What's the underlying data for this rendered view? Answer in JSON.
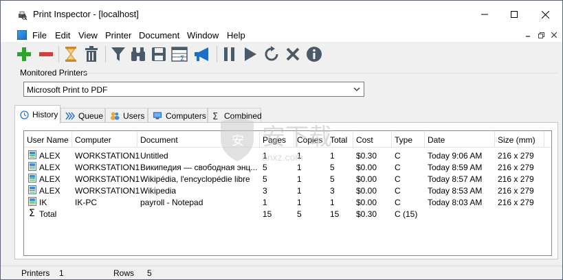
{
  "window": {
    "title": "Print Inspector - [localhost]"
  },
  "menu": [
    "File",
    "Edit",
    "View",
    "Printer",
    "Document",
    "Window",
    "Help"
  ],
  "toolbar": {
    "icons": [
      "add-icon",
      "remove-icon",
      "hourglass-icon",
      "trash-icon",
      "filter-icon",
      "binoculars-icon",
      "save-icon",
      "columns-sum-icon",
      "megaphone-icon",
      "pause-icon",
      "play-icon",
      "refresh-icon",
      "cancel-icon",
      "info-icon"
    ]
  },
  "monitored": {
    "label": "Monitored Printers",
    "selected": "Microsoft Print to PDF"
  },
  "tabs": [
    {
      "label": "History"
    },
    {
      "label": "Queue"
    },
    {
      "label": "Users"
    },
    {
      "label": "Computers"
    },
    {
      "label": "Combined"
    }
  ],
  "table": {
    "columns": [
      "User Name",
      "Computer",
      "Document",
      "Pages",
      "Copies",
      "Total",
      "Cost",
      "Type",
      "Date",
      "Size (mm)"
    ],
    "rows": [
      {
        "user": "ALEX",
        "computer": "WORKSTATION1",
        "document": "Untitled",
        "pages": "1",
        "copies": "1",
        "total": "1",
        "cost": "$0.30",
        "type": "C",
        "date": "Today 9:06 AM",
        "size": "216 x 279"
      },
      {
        "user": "ALEX",
        "computer": "WORKSTATION1",
        "document": "Википедия — свободная энц...",
        "pages": "5",
        "copies": "1",
        "total": "5",
        "cost": "$0.00",
        "type": "C",
        "date": "Today 8:59 AM",
        "size": "216 x 279"
      },
      {
        "user": "ALEX",
        "computer": "WORKSTATION1",
        "document": "Wikipédia, l'encyclopédie libre",
        "pages": "5",
        "copies": "1",
        "total": "5",
        "cost": "$0.00",
        "type": "C",
        "date": "Today 8:57 AM",
        "size": "216 x 279"
      },
      {
        "user": "ALEX",
        "computer": "WORKSTATION1",
        "document": "Wikipedia",
        "pages": "3",
        "copies": "1",
        "total": "3",
        "cost": "$0.00",
        "type": "C",
        "date": "Today 8:53 AM",
        "size": "216 x 279"
      },
      {
        "user": "IK",
        "computer": "IK-PC",
        "document": "payroll - Notepad",
        "pages": "1",
        "copies": "1",
        "total": "1",
        "cost": "$0.00",
        "type": "C",
        "date": "Today 8:03 AM",
        "size": "216 x 279"
      }
    ],
    "total_row": {
      "label": "Total",
      "pages": "15",
      "copies": "5",
      "total": "15",
      "cost": "$0.30",
      "type": "C (15)"
    }
  },
  "status": {
    "printers_label": "Printers",
    "printers_value": "1",
    "rows_label": "Rows",
    "rows_value": "5"
  },
  "watermark": {
    "text": "anxz.com"
  },
  "colors": {
    "accent_green": "#2aa52a",
    "accent_red": "#d83b3b",
    "toolbar_gray": "#4a5a68",
    "megaphone_blue": "#1c6fc9"
  }
}
